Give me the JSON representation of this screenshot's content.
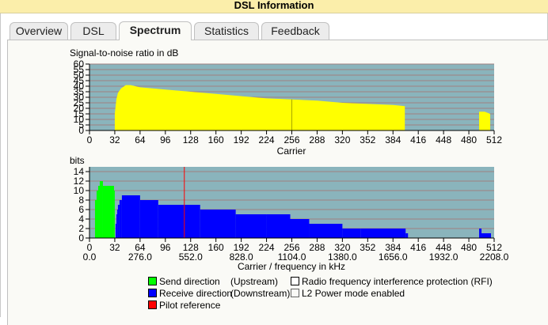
{
  "header": {
    "title": "DSL Information"
  },
  "tabs": [
    {
      "label": "Overview"
    },
    {
      "label": "DSL"
    },
    {
      "label": "Spectrum"
    },
    {
      "label": "Statistics"
    },
    {
      "label": "Feedback"
    }
  ],
  "active_tab": "Spectrum",
  "chart_data": [
    {
      "type": "area",
      "title": "Signal-to-noise ratio in dB",
      "xlabel": "Carrier",
      "ylim": [
        0,
        60
      ],
      "xlim": [
        0,
        512
      ],
      "yticks": [
        "0",
        "5",
        "10",
        "15",
        "20",
        "25",
        "30",
        "35",
        "40",
        "45",
        "50",
        "55",
        "60"
      ],
      "xticks": [
        "0",
        "32",
        "64",
        "96",
        "128",
        "160",
        "192",
        "224",
        "256",
        "288",
        "320",
        "352",
        "384",
        "416",
        "448",
        "480",
        "512"
      ],
      "color": "#ffff00",
      "points": [
        [
          32,
          0
        ],
        [
          32,
          15
        ],
        [
          34,
          28
        ],
        [
          36,
          34
        ],
        [
          40,
          38
        ],
        [
          46,
          41
        ],
        [
          52,
          41
        ],
        [
          64,
          39
        ],
        [
          96,
          37
        ],
        [
          128,
          35
        ],
        [
          160,
          33
        ],
        [
          192,
          31
        ],
        [
          224,
          29
        ],
        [
          256,
          28
        ],
        [
          288,
          27
        ],
        [
          320,
          25
        ],
        [
          352,
          24
        ],
        [
          384,
          23
        ],
        [
          399,
          22
        ],
        [
          399,
          0
        ],
        [
          493,
          0
        ],
        [
          493,
          17
        ],
        [
          500,
          17
        ],
        [
          507,
          15
        ],
        [
          507,
          0
        ]
      ],
      "marker_carrier": 256
    },
    {
      "type": "bar",
      "title": "bits",
      "xlabel": "Carrier / frequency in kHz",
      "ylim": [
        0,
        15
      ],
      "xlim": [
        0,
        512
      ],
      "yticks": [
        "0",
        "2",
        "4",
        "6",
        "8",
        "10",
        "12",
        "14"
      ],
      "xticks": [
        "0",
        "32",
        "64",
        "96",
        "128",
        "160",
        "192",
        "224",
        "256",
        "288",
        "320",
        "352",
        "384",
        "416",
        "448",
        "480",
        "512"
      ],
      "xticks2": [
        "0.0",
        "276.0",
        "552.0",
        "828.0",
        "1104.0",
        "1380.0",
        "1656.0",
        "1932.0",
        "2208.0"
      ],
      "upstream": [
        [
          7,
          8,
          8
        ],
        [
          9,
          10,
          10
        ],
        [
          11,
          12,
          11
        ],
        [
          13,
          16,
          12
        ],
        [
          17,
          30,
          11
        ],
        [
          31,
          31,
          10
        ]
      ],
      "downstream": [
        [
          33,
          33,
          3
        ],
        [
          34,
          34,
          5
        ],
        [
          35,
          35,
          6
        ],
        [
          36,
          37,
          7
        ],
        [
          38,
          40,
          8
        ],
        [
          41,
          63,
          9
        ],
        [
          64,
          86,
          8
        ],
        [
          87,
          139,
          7
        ],
        [
          140,
          184,
          6
        ],
        [
          185,
          223,
          5
        ],
        [
          224,
          253,
          5
        ],
        [
          254,
          277,
          4
        ],
        [
          278,
          319,
          3
        ],
        [
          320,
          342,
          2
        ],
        [
          343,
          399,
          2
        ],
        [
          400,
          402,
          1
        ],
        [
          493,
          495,
          2
        ],
        [
          496,
          507,
          1
        ]
      ],
      "pilot_carrier": 120,
      "colors": {
        "upstream": "#00ff00",
        "downstream": "#0000ff",
        "pilot": "#ff0000",
        "background": "#8ab4bc"
      }
    }
  ],
  "legend": {
    "send": "Send direction",
    "upstream": "(Upstream)",
    "receive": "Receive direction",
    "downstream": "(Downstream)",
    "pilot": "Pilot reference",
    "rfi": "Radio frequency interference protection (RFI)",
    "l2": "L2 Power mode enabled"
  }
}
